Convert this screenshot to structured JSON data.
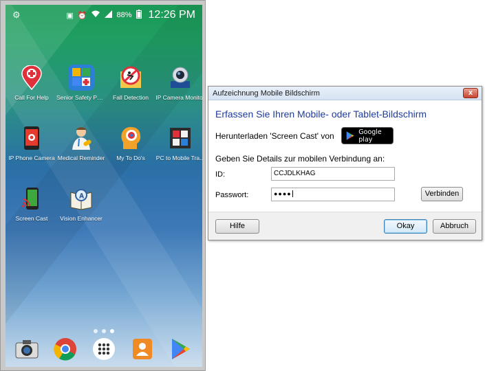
{
  "phone": {
    "status": {
      "left_icon": "notification-icon",
      "battery": "88%",
      "time": "12:26 PM"
    },
    "apps": [
      {
        "label": "Call For Help",
        "icon": "map-pin-plus-icon",
        "color": "#e0303c"
      },
      {
        "label": "Senior Safety Pho...",
        "icon": "safety-phone-icon",
        "color": "#2d7ed6"
      },
      {
        "label": "Fall Detection",
        "icon": "fall-detection-icon",
        "color": "#e9e9e9"
      },
      {
        "label": "IP Camera Monitor",
        "icon": "ip-camera-icon",
        "color": "#cfd6e0"
      },
      {
        "label": "IP Phone Camera",
        "icon": "phone-camera-icon",
        "color": "#e53a2e"
      },
      {
        "label": "Medical Reminder",
        "icon": "doctor-icon",
        "color": "#e8eef2"
      },
      {
        "label": "My To Do's",
        "icon": "todo-head-icon",
        "color": "#f2a22a"
      },
      {
        "label": "PC to Mobile Tra...",
        "icon": "pc-mobile-icon",
        "color": "#3a3a3a"
      },
      {
        "label": "Screen Cast",
        "icon": "screen-cast-icon",
        "color": "#2f8a2f"
      },
      {
        "label": "Vision Enhancer",
        "icon": "vision-book-icon",
        "color": "#e6e0d0"
      }
    ],
    "dock": [
      {
        "name": "camera-icon"
      },
      {
        "name": "chrome-icon"
      },
      {
        "name": "app-drawer-icon"
      },
      {
        "name": "contacts-icon"
      },
      {
        "name": "play-store-icon"
      }
    ]
  },
  "dialog": {
    "title": "Aufzeichnung Mobile Bildschirm",
    "close_label": "x",
    "heading": "Erfassen Sie Ihren Mobile- oder Tablet-Bildschirm",
    "download_text": "Herunterladen 'Screen Cast' von",
    "google_play_label": "Google play",
    "details_text": "Geben Sie Details zur mobilen Verbindung an:",
    "id_label": "ID:",
    "id_value": "CCJDLKHAG",
    "password_label": "Passwort:",
    "password_value": "●●●●",
    "connect_label": "Verbinden",
    "help_label": "Hilfe",
    "ok_label": "Okay",
    "cancel_label": "Abbruch"
  }
}
